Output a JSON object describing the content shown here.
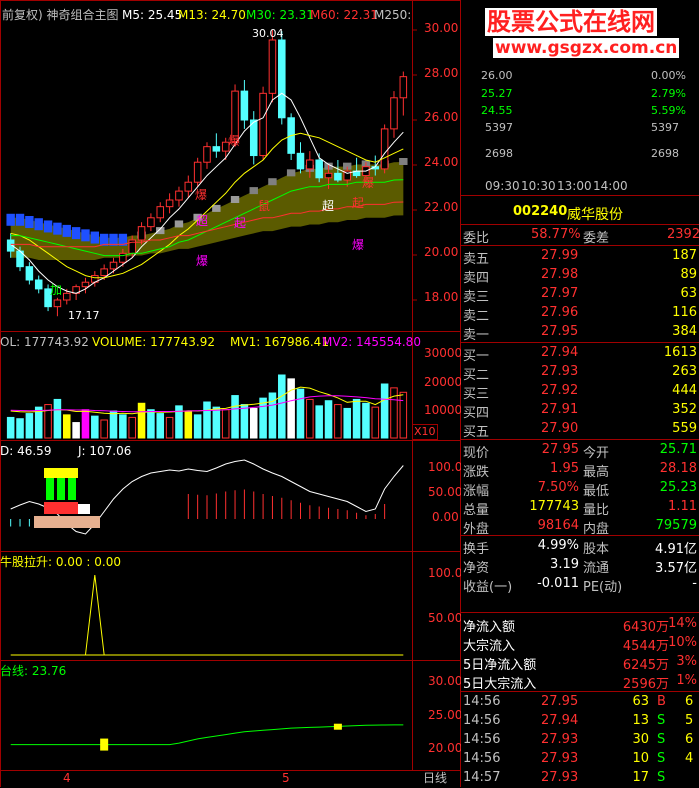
{
  "main": {
    "header": "前复权) 神奇组合主图",
    "indicators": [
      {
        "label": "M5: 25.45",
        "color": "#ffffff"
      },
      {
        "label": "M13: 24.70",
        "color": "#ffff00"
      },
      {
        "label": "M30: 23.31",
        "color": "#00ff00"
      },
      {
        "label": "M60: 22.31",
        "color": "#ff3030"
      },
      {
        "label": "M250:",
        "color": "#c0c0c0"
      }
    ],
    "y_ticks": [
      "30.00",
      "28.00",
      "26.00",
      "24.00",
      "22.00",
      "20.00",
      "18.00"
    ],
    "hi_label": "30.04",
    "lo_label": "17.17",
    "annotations": [
      {
        "text": "爆",
        "color": "#ff3030"
      },
      {
        "text": "爆",
        "color": "#ff3030"
      },
      {
        "text": "鼠",
        "color": "#ff3030"
      },
      {
        "text": "超",
        "color": "#ffffff"
      },
      {
        "text": "起",
        "color": "#ff3030"
      },
      {
        "text": "爆",
        "color": "#ff3030"
      },
      {
        "text": "爆",
        "color": "#ff00ff"
      },
      {
        "text": "爆",
        "color": "#ff00ff"
      },
      {
        "text": "加",
        "color": "#00ff00"
      },
      {
        "text": "超",
        "color": "#ff00ff"
      },
      {
        "text": "起",
        "color": "#ff00ff"
      }
    ]
  },
  "volume": {
    "header": "OL: 177743.92",
    "volume_label": "VOLUME: 177743.92",
    "mv1": "MV1: 167986.41",
    "mv2": "MV2: 145554.80",
    "y_ticks": [
      "30000",
      "20000",
      "10000"
    ],
    "unit": "X10"
  },
  "kdj": {
    "d": "D: 46.59",
    "j": "J: 107.06",
    "y_ticks": [
      "100.0",
      "50.00",
      "0.00"
    ]
  },
  "pull": {
    "header": "牛股拉升: 0.00 : 0.00",
    "y_ticks": [
      "100.0",
      "50.00"
    ]
  },
  "line": {
    "header": "台线: 23.76",
    "y_ticks": [
      "30.00",
      "25.00",
      "20.00"
    ]
  },
  "x_axis": {
    "labels": [
      "4",
      "5"
    ],
    "period": "日线"
  },
  "watermark": {
    "line1": "股票公式在线网",
    "line2": "www.gsgzx.com.cn"
  },
  "mini_chart": {
    "left_ticks": [
      "26.00",
      "25.27",
      "24.55",
      "5397",
      "2698"
    ],
    "right_ticks": [
      "0.00%",
      "2.79%",
      "5.59%",
      "5397",
      "2698"
    ],
    "time_labels": [
      "09:30",
      "10:30",
      "13:00",
      "14:00"
    ]
  },
  "stock": {
    "code": "002240",
    "name": "威华股份"
  },
  "ratio": {
    "label1": "委比",
    "value1": "58.77%",
    "label2": "委差",
    "value2": "2392"
  },
  "asks": [
    {
      "label": "卖五",
      "price": "27.99",
      "vol": "187"
    },
    {
      "label": "卖四",
      "price": "27.98",
      "vol": "89"
    },
    {
      "label": "卖三",
      "price": "27.97",
      "vol": "63"
    },
    {
      "label": "卖二",
      "price": "27.96",
      "vol": "116"
    },
    {
      "label": "卖一",
      "price": "27.95",
      "vol": "384"
    }
  ],
  "bids": [
    {
      "label": "买一",
      "price": "27.94",
      "vol": "1613"
    },
    {
      "label": "买二",
      "price": "27.93",
      "vol": "263"
    },
    {
      "label": "买三",
      "price": "27.92",
      "vol": "444"
    },
    {
      "label": "买四",
      "price": "27.91",
      "vol": "352"
    },
    {
      "label": "买五",
      "price": "27.90",
      "vol": "559"
    }
  ],
  "quote": [
    {
      "l1": "现价",
      "v1": "27.95",
      "c1": "#ff3030",
      "l2": "今开",
      "v2": "25.71",
      "c2": "#00ff00"
    },
    {
      "l1": "涨跌",
      "v1": "1.95",
      "c1": "#ff3030",
      "l2": "最高",
      "v2": "28.18",
      "c2": "#ff3030"
    },
    {
      "l1": "涨幅",
      "v1": "7.50%",
      "c1": "#ff3030",
      "l2": "最低",
      "v2": "25.23",
      "c2": "#00ff00"
    },
    {
      "l1": "总量",
      "v1": "177743",
      "c1": "#ffff00",
      "l2": "量比",
      "v2": "1.11",
      "c2": "#ff3030"
    },
    {
      "l1": "外盘",
      "v1": "98164",
      "c1": "#ff3030",
      "l2": "内盘",
      "v2": "79579",
      "c2": "#00ff00"
    }
  ],
  "finance": [
    {
      "l1": "换手",
      "v1": "4.99%",
      "l2": "股本",
      "v2": "4.91亿"
    },
    {
      "l1": "净资",
      "v1": "3.19",
      "l2": "流通",
      "v2": "3.57亿"
    },
    {
      "l1": "收益(一)",
      "v1": "-0.011",
      "l2": "PE(动)",
      "v2": "-"
    }
  ],
  "flows": [
    {
      "label": "净流入额",
      "amount": "6430万",
      "pct": "14%"
    },
    {
      "label": "大宗流入",
      "amount": "4544万",
      "pct": "10%"
    },
    {
      "label": "5日净流入额",
      "amount": "6245万",
      "pct": "3%"
    },
    {
      "label": "5日大宗流入",
      "amount": "2596万",
      "pct": "1%"
    }
  ],
  "ticks": [
    {
      "time": "14:56",
      "price": "27.95",
      "vol": "63",
      "side": "B",
      "n": "6",
      "sidecolor": "#ff3030"
    },
    {
      "time": "14:56",
      "price": "27.94",
      "vol": "13",
      "side": "S",
      "n": "5",
      "sidecolor": "#00ff00"
    },
    {
      "time": "14:56",
      "price": "27.93",
      "vol": "30",
      "side": "S",
      "n": "6",
      "sidecolor": "#00ff00"
    },
    {
      "time": "14:56",
      "price": "27.93",
      "vol": "10",
      "side": "S",
      "n": "4",
      "sidecolor": "#00ff00"
    },
    {
      "time": "14:57",
      "price": "27.93",
      "vol": "17",
      "side": "S",
      "n": "",
      "sidecolor": "#00ff00"
    }
  ],
  "chart_data": {
    "type": "candlestick",
    "price_ylim": [
      17,
      30.5
    ],
    "candles": [
      [
        20.6,
        20.9,
        19.8,
        20.1
      ],
      [
        20.1,
        20.3,
        19.2,
        19.4
      ],
      [
        19.4,
        19.6,
        18.6,
        18.8
      ],
      [
        18.8,
        19.0,
        18.2,
        18.4
      ],
      [
        18.4,
        18.6,
        17.4,
        17.6
      ],
      [
        17.6,
        18.0,
        17.17,
        17.9
      ],
      [
        17.9,
        18.4,
        17.7,
        18.2
      ],
      [
        18.2,
        18.6,
        17.9,
        18.5
      ],
      [
        18.5,
        18.9,
        18.2,
        18.7
      ],
      [
        18.7,
        19.2,
        18.5,
        19.0
      ],
      [
        19.0,
        19.5,
        18.8,
        19.3
      ],
      [
        19.3,
        19.8,
        19.1,
        19.6
      ],
      [
        19.6,
        20.2,
        19.4,
        20.0
      ],
      [
        20.0,
        20.8,
        19.8,
        20.6
      ],
      [
        20.6,
        21.4,
        20.4,
        21.2
      ],
      [
        21.2,
        21.8,
        21.0,
        21.6
      ],
      [
        21.6,
        22.3,
        21.4,
        22.1
      ],
      [
        22.1,
        22.7,
        21.8,
        22.4
      ],
      [
        22.4,
        23.0,
        22.1,
        22.8
      ],
      [
        22.8,
        23.5,
        22.5,
        23.2
      ],
      [
        23.2,
        24.3,
        23.0,
        24.1
      ],
      [
        24.1,
        25.0,
        23.8,
        24.8
      ],
      [
        24.8,
        25.4,
        24.3,
        24.6
      ],
      [
        24.6,
        25.2,
        24.2,
        25.0
      ],
      [
        25.0,
        27.6,
        24.8,
        27.3
      ],
      [
        27.3,
        27.8,
        25.6,
        26.0
      ],
      [
        26.0,
        26.4,
        24.0,
        24.4
      ],
      [
        24.4,
        27.5,
        24.2,
        27.2
      ],
      [
        27.2,
        30.04,
        26.8,
        29.6
      ],
      [
        29.6,
        30.0,
        25.8,
        26.1
      ],
      [
        26.1,
        26.3,
        24.2,
        24.5
      ],
      [
        24.5,
        25.0,
        23.6,
        23.8
      ],
      [
        23.8,
        24.6,
        23.4,
        24.2
      ],
      [
        24.2,
        24.5,
        23.2,
        23.4
      ],
      [
        23.4,
        24.0,
        22.9,
        23.6
      ],
      [
        23.6,
        24.2,
        23.2,
        23.3
      ],
      [
        23.3,
        23.9,
        23.0,
        23.7
      ],
      [
        23.7,
        24.3,
        23.4,
        23.5
      ],
      [
        23.5,
        24.1,
        23.1,
        23.9
      ],
      [
        23.9,
        24.4,
        23.5,
        23.8
      ],
      [
        23.8,
        25.8,
        23.6,
        25.6
      ],
      [
        25.6,
        27.3,
        25.2,
        27.0
      ],
      [
        27.0,
        28.18,
        26.2,
        27.95
      ]
    ],
    "ma5": [
      20.4,
      20.1,
      19.7,
      19.2,
      18.8,
      18.5,
      18.3,
      18.2,
      18.4,
      18.7,
      18.9,
      19.2,
      19.5,
      19.8,
      20.3,
      20.7,
      21.1,
      21.6,
      22.0,
      22.5,
      23.0,
      23.5,
      23.9,
      24.3,
      24.9,
      25.5,
      25.9,
      26.1,
      26.9,
      27.2,
      26.9,
      26.1,
      25.2,
      24.3,
      24.0,
      23.8,
      23.6,
      23.7,
      23.7,
      23.9,
      24.5,
      25.0,
      25.45
    ],
    "ma13": [
      20.9,
      20.8,
      20.6,
      20.3,
      20.0,
      19.7,
      19.4,
      19.2,
      19.0,
      18.9,
      18.9,
      19.0,
      19.1,
      19.3,
      19.5,
      19.8,
      20.1,
      20.4,
      20.8,
      21.1,
      21.5,
      21.9,
      22.3,
      22.7,
      23.2,
      23.6,
      23.9,
      24.2,
      24.7,
      25.1,
      25.3,
      25.4,
      25.3,
      25.2,
      25.0,
      24.8,
      24.6,
      24.4,
      24.2,
      24.1,
      24.3,
      24.5,
      24.7
    ],
    "ma30": [
      20.8,
      20.8,
      20.7,
      20.6,
      20.5,
      20.4,
      20.3,
      20.2,
      20.1,
      20.0,
      19.9,
      19.9,
      19.9,
      20.0,
      20.0,
      20.1,
      20.2,
      20.3,
      20.5,
      20.6,
      20.8,
      21.0,
      21.2,
      21.4,
      21.6,
      21.8,
      22.0,
      22.2,
      22.4,
      22.6,
      22.8,
      22.9,
      23.0,
      23.0,
      23.1,
      23.1,
      23.1,
      23.2,
      23.2,
      23.2,
      23.2,
      23.3,
      23.31
    ],
    "ma60": [
      20.4,
      20.4,
      20.4,
      20.3,
      20.3,
      20.3,
      20.3,
      20.3,
      20.3,
      20.3,
      20.4,
      20.4,
      20.4,
      20.5,
      20.5,
      20.6,
      20.6,
      20.7,
      20.8,
      20.8,
      20.9,
      21.0,
      21.1,
      21.2,
      21.3,
      21.4,
      21.5,
      21.6,
      21.6,
      21.7,
      21.8,
      21.8,
      21.9,
      21.9,
      22.0,
      22.0,
      22.1,
      22.1,
      22.2,
      22.2,
      22.2,
      22.3,
      22.31
    ],
    "volume_ylim": [
      0,
      35000
    ],
    "volumes": [
      8000,
      7500,
      9500,
      12000,
      13000,
      15000,
      9000,
      6000,
      11000,
      8500,
      7000,
      10500,
      9000,
      8000,
      13500,
      11000,
      9500,
      8000,
      12500,
      10500,
      9000,
      14000,
      12000,
      11000,
      16500,
      13000,
      11500,
      15500,
      17500,
      24500,
      23000,
      19000,
      15000,
      12500,
      14500,
      13000,
      11500,
      15000,
      13500,
      12000,
      21000,
      19500,
      17774
    ],
    "mv1": [
      10500,
      10200,
      10100,
      10300,
      10700,
      11000,
      10900,
      10300,
      10400,
      10000,
      9600,
      9400,
      9600,
      9400,
      9900,
      10200,
      10000,
      10100,
      10300,
      10600,
      10500,
      10800,
      11300,
      11500,
      12400,
      12800,
      13100,
      13600,
      14200,
      16300,
      18600,
      19800,
      19400,
      18000,
      16900,
      15600,
      13900,
      14300,
      14300,
      13000,
      14900,
      16300,
      16799
    ],
    "mv2": [
      10800,
      10700,
      10600,
      10700,
      10800,
      11000,
      11000,
      10900,
      10900,
      10700,
      10600,
      10400,
      10300,
      10200,
      10200,
      10300,
      10300,
      10300,
      10400,
      10500,
      10600,
      10700,
      10800,
      11000,
      11300,
      11600,
      11900,
      12300,
      12800,
      13600,
      14500,
      15300,
      16000,
      16300,
      16400,
      16400,
      16200,
      16000,
      15700,
      15300,
      15100,
      14900,
      14555
    ],
    "volume_colors": [
      "c",
      "c",
      "c",
      "c",
      "r",
      "c",
      "y",
      "w",
      "m",
      "c",
      "r",
      "c",
      "c",
      "r",
      "y",
      "c",
      "c",
      "r",
      "c",
      "y",
      "c",
      "c",
      "c",
      "r",
      "c",
      "c",
      "w",
      "c",
      "c",
      "c",
      "w",
      "c",
      "r",
      "c",
      "c",
      "r",
      "c",
      "c",
      "c",
      "r",
      "c",
      "r",
      "r"
    ],
    "kdj_ylim": [
      -60,
      140
    ],
    "k": [
      20,
      28,
      35,
      30,
      22,
      10,
      -10,
      -25,
      -30,
      -10,
      15,
      40,
      60,
      75,
      85,
      92,
      95,
      98,
      96,
      100,
      97,
      95,
      102,
      110,
      115,
      118,
      110,
      100,
      92,
      85,
      75,
      65,
      55,
      50,
      45,
      40,
      35,
      25,
      15,
      20,
      60,
      85,
      107
    ],
    "pull_ylim": [
      0,
      120
    ],
    "pull": [
      0,
      0,
      0,
      0,
      0,
      0,
      0,
      0,
      0,
      0,
      0,
      0,
      0,
      0,
      0,
      0,
      0,
      0,
      0,
      0,
      0,
      0,
      0,
      0,
      0,
      0,
      0,
      0,
      0,
      0,
      0,
      0,
      0,
      0,
      0,
      0,
      0,
      0,
      0,
      0,
      0,
      0,
      0
    ],
    "line_ylim": [
      18,
      32
    ],
    "line": [
      21.0,
      21.0,
      21.0,
      21.0,
      21.0,
      21.0,
      21.0,
      21.0,
      21.0,
      21.0,
      21.0,
      21.0,
      21.0,
      21.0,
      21.0,
      21.0,
      21.0,
      21.0,
      21.2,
      21.5,
      21.8,
      22.0,
      22.2,
      22.4,
      22.6,
      22.8,
      22.9,
      23.0,
      23.1,
      23.2,
      23.3,
      23.35,
      23.4,
      23.45,
      23.5,
      23.55,
      23.6,
      23.65,
      23.7,
      23.72,
      23.74,
      23.75,
      23.76
    ]
  }
}
